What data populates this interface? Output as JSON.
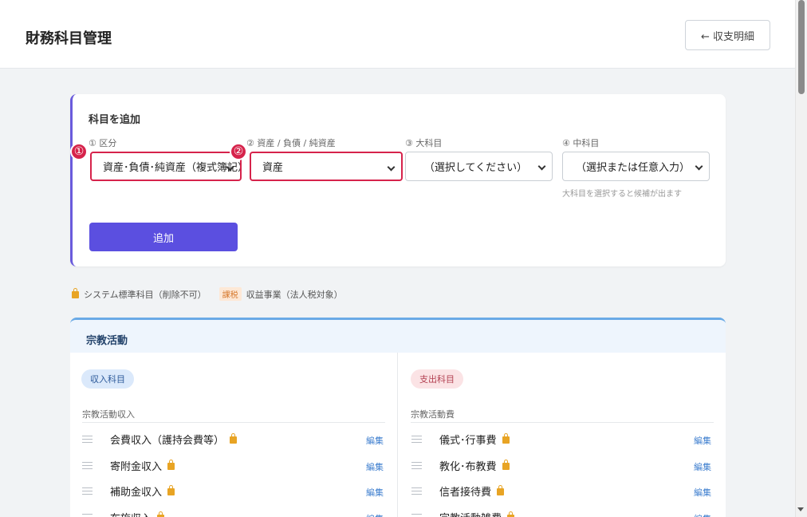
{
  "header": {
    "title": "財務科目管理",
    "back_label": "← 収支明細"
  },
  "add_form": {
    "title": "科目を追加",
    "fields": [
      {
        "label": "① 区分",
        "value": "資産･負債･純資産（複式簿記）"
      },
      {
        "label": "② 資産 / 負債 / 純資産",
        "value": "資産"
      },
      {
        "label": "③ 大科目",
        "value": "（選択してください）"
      },
      {
        "label": "④ 中科目",
        "value": "（選択または任意入力）"
      }
    ],
    "hint": "大科目を選択すると候補が出ます",
    "add_label": "追加",
    "markers": [
      "①",
      "②"
    ]
  },
  "legend": {
    "system_text": "システム標準科目（削除不可）",
    "tax_tag": "課税",
    "tax_text": "収益事業（法人税対象）"
  },
  "section": {
    "title": "宗教活動",
    "income": {
      "pill": "収入科目",
      "group": "宗教活動収入",
      "items": [
        "会費収入（護持会費等）",
        "寄附金収入",
        "補助金収入",
        "布施収入"
      ]
    },
    "expense": {
      "pill": "支出科目",
      "group": "宗教活動費",
      "items": [
        "儀式･行事費",
        "教化･布教費",
        "信者接待費",
        "宗教活動雑費"
      ]
    },
    "edit_label": "編集"
  },
  "colors": {
    "accent": "#5b4fe0",
    "highlight": "#d6234b",
    "section_border": "#6aaae6"
  }
}
